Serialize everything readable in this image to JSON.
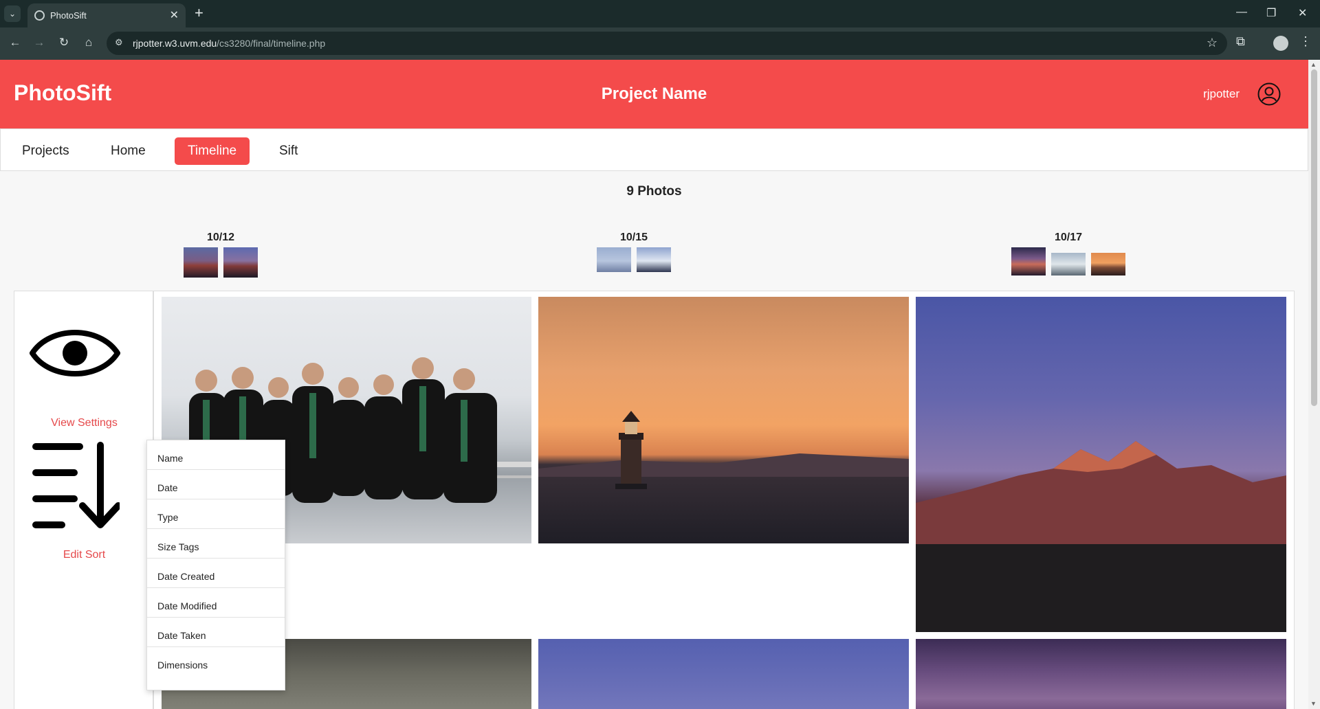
{
  "browser": {
    "tab_title": "PhotoSift",
    "url_host": "rjpotter.w3.uvm.edu",
    "url_path": "/cs3280/final/timeline.php"
  },
  "header": {
    "brand": "PhotoSift",
    "project_name": "Project Name",
    "username": "rjpotter"
  },
  "nav": {
    "items": [
      {
        "label": "Projects"
      },
      {
        "label": "Home"
      },
      {
        "label": "Timeline",
        "active": true
      },
      {
        "label": "Sift"
      }
    ]
  },
  "photo_count": "9 Photos",
  "timeline": [
    {
      "date": "10/12",
      "thumbs": 2
    },
    {
      "date": "10/15",
      "thumbs": 2
    },
    {
      "date": "10/17",
      "thumbs": 3
    }
  ],
  "sidebar": {
    "view_settings_label": "View Settings",
    "edit_sort_label": "Edit Sort"
  },
  "sort_menu": {
    "options": [
      "Name",
      "Date",
      "Type",
      "Size Tags",
      "Date Created",
      "Date Modified",
      "Date Taken",
      "Dimensions"
    ]
  },
  "colors": {
    "accent": "#f44b4b",
    "link": "#e5484a"
  }
}
